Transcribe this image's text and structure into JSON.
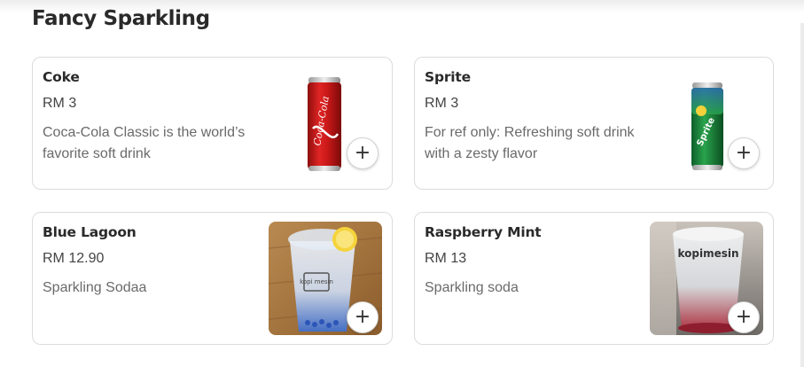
{
  "section": {
    "title": "Fancy Sparkling"
  },
  "products": [
    {
      "name": "Coke",
      "price": "RM 3",
      "description": "Coca-Cola Classic is the world’s favorite soft drink",
      "image": "coca-cola-can",
      "can_text": "Coca-Cola",
      "add_icon": "+"
    },
    {
      "name": "Sprite",
      "price": "RM 3",
      "description": "For ref only: Refreshing soft drink with a zesty flavor",
      "image": "sprite-can",
      "can_text": "Sprite",
      "add_icon": "+"
    },
    {
      "name": "Blue Lagoon",
      "price": "RM 12.90",
      "description": "Sparkling Sodaa",
      "image": "blue-lagoon-drink-photo",
      "cup_logo": "kopi mesin",
      "add_icon": "+"
    },
    {
      "name": "Raspberry Mint",
      "price": "RM 13",
      "description": "Sparkling soda",
      "image": "raspberry-mint-drink-photo",
      "cup_logo": "kopimesin",
      "add_icon": "+"
    }
  ],
  "colors": {
    "coke_red": "#d01e1e",
    "sprite_green": "#1b8a3a",
    "sprite_blue": "#2f6fb5",
    "lagoon_blue": "#4a7fd6",
    "raspberry": "#c23a4f"
  }
}
